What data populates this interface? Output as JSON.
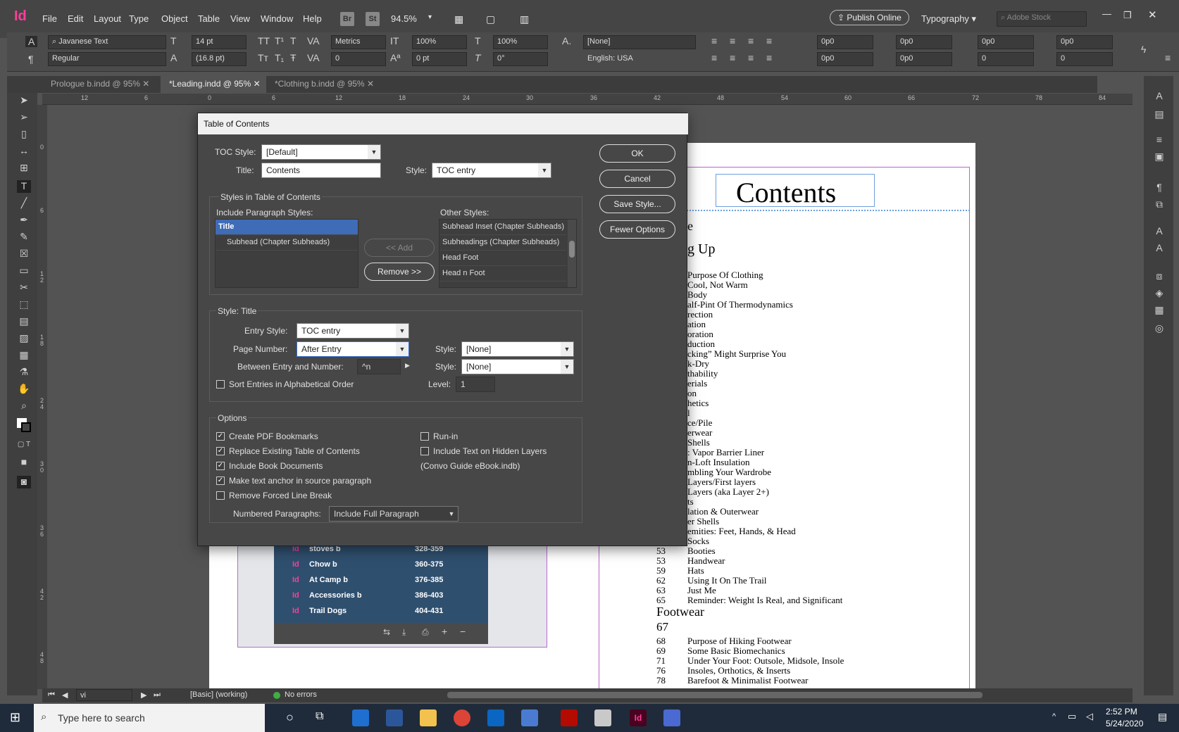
{
  "app": {
    "logo": "Id",
    "menus": [
      "File",
      "Edit",
      "Layout",
      "Type",
      "Object",
      "Table",
      "View",
      "Window",
      "Help"
    ],
    "bridge": "Br",
    "stock": "St",
    "zoom": "94.5%",
    "publish_online": "Publish Online",
    "workspace": "Typography",
    "search_placeholder": "Adobe Stock"
  },
  "control_bar": {
    "font_family": "Javanese Text",
    "font_style": "Regular",
    "font_size": "14 pt",
    "leading": "(16.8 pt)",
    "kerning": "Metrics",
    "tracking": "0",
    "vscale": "100%",
    "hscale": "100%",
    "baseline": "0 pt",
    "skew": "0°",
    "char_style": "[None]",
    "language": "English: USA",
    "indent_fields": [
      "0p0",
      "0p0",
      "0p0",
      "0p0"
    ],
    "indent_fields2": [
      "0p0",
      "0p0",
      "0",
      "0"
    ]
  },
  "tabs": [
    {
      "label": "Prologue b.indd @ 95%"
    },
    {
      "label": "*Leading.indd @ 95%"
    },
    {
      "label": "*Clothing b.indd @ 95%"
    }
  ],
  "ruler_labels": [
    "12",
    "6",
    "0",
    "6",
    "12",
    "18",
    "24",
    "30",
    "36",
    "42",
    "48",
    "54",
    "60",
    "66",
    "72",
    "78",
    "84"
  ],
  "vruler_labels": [
    "0",
    "6",
    "1\n2",
    "1\n8",
    "2\n4",
    "3\n0",
    "3\n6",
    "4\n2",
    "4\n8"
  ],
  "dialog": {
    "title": "Table of Contents",
    "toc_style_label": "TOC Style:",
    "toc_style": "[Default]",
    "title_label": "Title:",
    "title_value": "Contents",
    "style_label": "Style:",
    "title_style": "TOC entry",
    "buttons": {
      "ok": "OK",
      "cancel": "Cancel",
      "save_style": "Save Style...",
      "fewer": "Fewer Options"
    },
    "styles_group": "Styles in Table of Contents",
    "include_label": "Include Paragraph Styles:",
    "included": [
      "Title",
      "Subhead (Chapter Subheads)"
    ],
    "other_label": "Other Styles:",
    "others": [
      "Subhead Inset (Chapter Subheads)",
      "Subheadings (Chapter Subheads)",
      "Head Foot",
      "Head n Foot"
    ],
    "add_button": "<< Add",
    "remove_button": "Remove >>",
    "style_group": "Style: Title",
    "entry_style_label": "Entry Style:",
    "entry_style": "TOC entry",
    "page_number_label": "Page Number:",
    "page_number": "After Entry",
    "pn_style_label": "Style:",
    "pn_style": "[None]",
    "between_label": "Between Entry and Number:",
    "between_value": "^n",
    "between_style_label": "Style:",
    "between_style": "[None]",
    "sort_label": "Sort Entries in Alphabetical Order",
    "level_label": "Level:",
    "level_value": "1",
    "options_group": "Options",
    "options_left": [
      {
        "label": "Create PDF Bookmarks",
        "checked": "✓"
      },
      {
        "label": "Replace Existing Table of Contents",
        "checked": "✓"
      },
      {
        "label": "Include Book Documents",
        "checked": "✓"
      },
      {
        "label": "Make text anchor in source paragraph",
        "checked": "✓"
      },
      {
        "label": "Remove Forced Line Break",
        "checked": ""
      }
    ],
    "options_right": [
      {
        "label": "Run-in",
        "checked": ""
      },
      {
        "label": "Include Text on Hidden Layers",
        "checked": ""
      }
    ],
    "book_name": "(Convo Guide eBook.indb)",
    "numbered_label": "Numbered Paragraphs:",
    "numbered_value": "Include Full Paragraph"
  },
  "document": {
    "heading": "Contents",
    "partial_lines": [
      "e",
      "g Up",
      "Purpose Of Clothing",
      "Cool, Not Warm",
      "Body",
      "alf-Pint Of Thermodynamics",
      "rection",
      "ation",
      "oration",
      "duction",
      "cking” Might Surprise You",
      "k-Dry",
      "thability",
      "erials",
      "on",
      "hetics",
      "l",
      "ce/Pile",
      "erwear",
      "Shells",
      ": Vapor Barrier Liner",
      "n-Loft Insulation",
      "mbling Your Wardrobe",
      "Layers/First layers",
      "Layers (aka Layer 2+)",
      "ts",
      "lation & Outerwear",
      "er Shells",
      "emities: Feet, Hands, & Head"
    ],
    "entries": [
      {
        "num": "49",
        "text": "Socks"
      },
      {
        "num": "53",
        "text": "Booties"
      },
      {
        "num": "53",
        "text": "Handwear"
      },
      {
        "num": "59",
        "text": "Hats"
      },
      {
        "num": "62",
        "text": "Using It On The Trail"
      },
      {
        "num": "63",
        "text": "Just Me"
      },
      {
        "num": "65",
        "text": "Reminder: Weight Is Real, and Significant"
      }
    ],
    "section": "Footwear",
    "section_num": "67",
    "entries2": [
      {
        "num": "68",
        "text": "Purpose of Hiking Footwear"
      },
      {
        "num": "69",
        "text": "Some Basic Biomechanics"
      },
      {
        "num": "71",
        "text": "Under Your Foot: Outsole, Midsole, Insole"
      },
      {
        "num": "76",
        "text": "Insoles, Orthotics, & Inserts"
      },
      {
        "num": "78",
        "text": "Barefoot & Minimalist Footwear"
      }
    ]
  },
  "book_panel": {
    "rows": [
      {
        "name": "stoves b",
        "pages": "328-359"
      },
      {
        "name": "Chow b",
        "pages": "360-375"
      },
      {
        "name": "At Camp b",
        "pages": "376-385"
      },
      {
        "name": "Accessories b",
        "pages": "386-403"
      },
      {
        "name": "Trail Dogs",
        "pages": "404-431"
      }
    ]
  },
  "status_bar": {
    "page": "vi",
    "profile": "[Basic] (working)",
    "errors": "No errors"
  },
  "taskbar": {
    "search_placeholder": "Type here to search",
    "time": "2:52 PM",
    "date": "5/24/2020"
  }
}
